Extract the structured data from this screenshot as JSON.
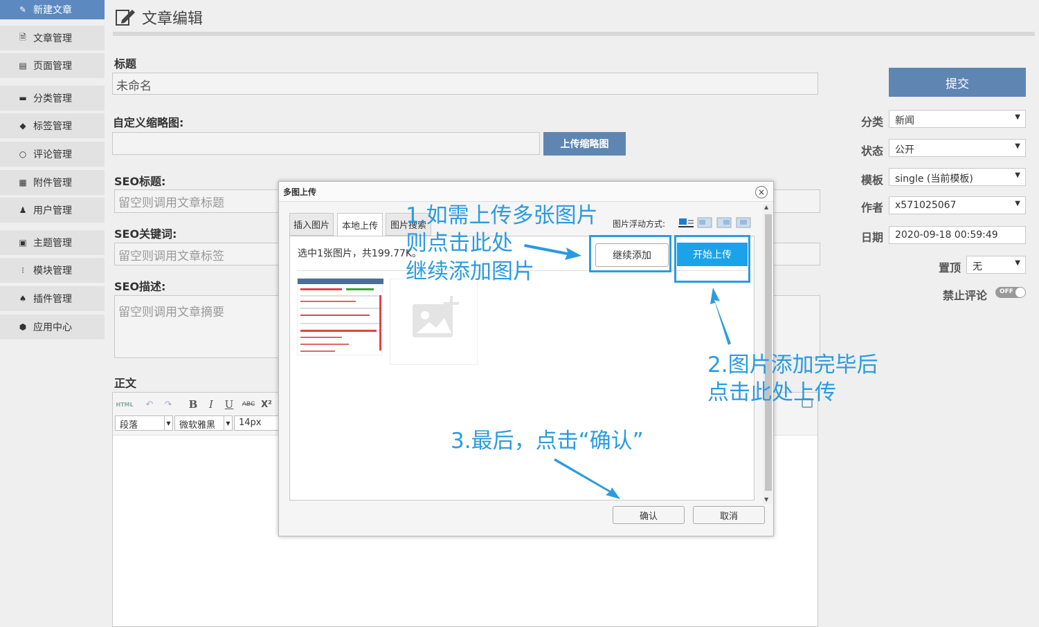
{
  "sidebar": {
    "items": [
      {
        "label": "新建文章",
        "icon": "edit-icon"
      },
      {
        "label": "文章管理",
        "icon": "document-icon"
      },
      {
        "label": "页面管理",
        "icon": "pages-icon"
      },
      {
        "label": "分类管理",
        "icon": "folder-icon"
      },
      {
        "label": "标签管理",
        "icon": "tag-icon"
      },
      {
        "label": "评论管理",
        "icon": "comment-icon"
      },
      {
        "label": "附件管理",
        "icon": "attachment-icon"
      },
      {
        "label": "用户管理",
        "icon": "user-icon"
      },
      {
        "label": "主题管理",
        "icon": "theme-icon"
      },
      {
        "label": "模块管理",
        "icon": "module-icon"
      },
      {
        "label": "插件管理",
        "icon": "plugin-icon"
      },
      {
        "label": "应用中心",
        "icon": "app-center-icon"
      }
    ]
  },
  "header": {
    "title": "文章编辑"
  },
  "form": {
    "title_label": "标题",
    "title_value": "未命名",
    "thumb_label": "自定义缩略图:",
    "thumb_value": "",
    "thumb_button": "上传缩略图",
    "seo_title_label": "SEO标题:",
    "seo_title_placeholder": "留空则调用文章标题",
    "seo_keywords_label": "SEO关键词:",
    "seo_keywords_placeholder": "留空则调用文章标签",
    "seo_desc_label": "SEO描述:",
    "seo_desc_placeholder": "留空则调用文章摘要",
    "body_label": "正文"
  },
  "editor": {
    "toolbar": {
      "html": "HTML",
      "bold": "B",
      "italic": "I",
      "underline": "U",
      "strike": "ABC",
      "superscript": "X²"
    },
    "paragraph": "段落",
    "font": "微软雅黑",
    "size": "14px"
  },
  "right_panel": {
    "submit": "提交",
    "category_label": "分类",
    "category_value": "新闻",
    "status_label": "状态",
    "status_value": "公开",
    "template_label": "模板",
    "template_value": "single (当前模板)",
    "author_label": "作者",
    "author_value": "x571025067",
    "date_label": "日期",
    "date_value": "2020-09-18 00:59:49",
    "top_label": "置顶",
    "top_value": "无",
    "no_comment_label": "禁止评论",
    "no_comment_toggle": "OFF"
  },
  "dialog": {
    "title": "多图上传",
    "close": "×",
    "tabs": [
      "插入图片",
      "本地上传",
      "图片搜索"
    ],
    "float_label": "图片浮动方式:",
    "status": "选中1张图片，共199.77K。",
    "continue_add": "继续添加",
    "start_upload": "开始上传",
    "confirm": "确认",
    "cancel": "取消"
  },
  "annotations": {
    "step1_line1": "1.如需上传多张图片",
    "step1_line2": "则点击此处",
    "step1_line3": "继续添加图片",
    "step2_line1": "2.图片添加完毕后",
    "step2_line2": "点击此处上传",
    "step3": "3.最后，点击“确认”"
  },
  "colors": {
    "accent": "#5c8ac0",
    "button_blue": "#5f86b3",
    "upload_blue": "#1aa3e8",
    "annotation": "#2a9be0"
  }
}
